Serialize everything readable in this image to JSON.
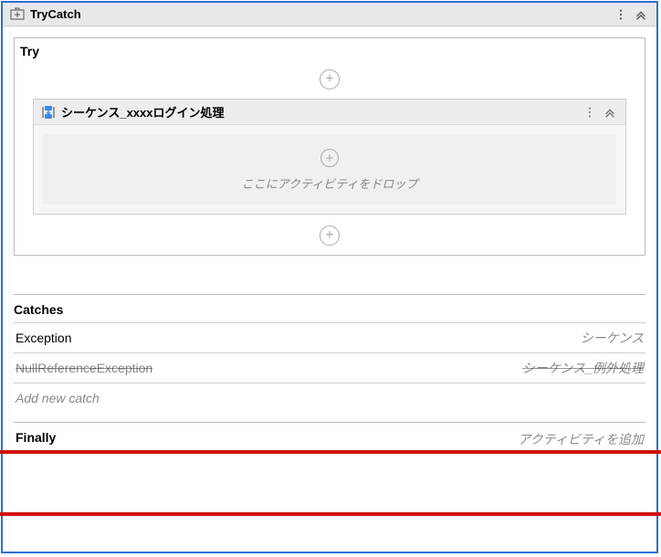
{
  "titlebar": {
    "title": "TryCatch"
  },
  "try": {
    "label": "Try",
    "sequence": {
      "title": "シーケンス_xxxxログイン処理",
      "drop_hint": "ここにアクティビティをドロップ"
    }
  },
  "catches": {
    "label": "Catches",
    "rows": [
      {
        "type": "Exception",
        "handler": "シーケンス"
      },
      {
        "type": "NullReferenceException",
        "handler": "シーケンス_例外処理"
      }
    ],
    "add_label": "Add new catch"
  },
  "finally": {
    "label": "Finally",
    "add_label": "アクティビティを追加"
  },
  "icons": {
    "menu": "menu-icon",
    "collapse": "chevron-up-icon",
    "trycatch": "trycatch-icon",
    "sequence": "sequence-icon",
    "plus": "+"
  }
}
